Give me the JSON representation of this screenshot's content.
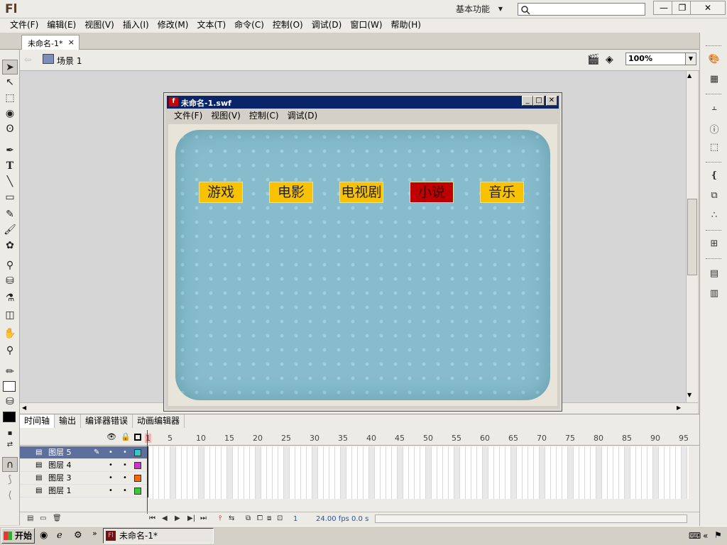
{
  "app": {
    "logo": "Fl",
    "workspace": "基本功能",
    "search_placeholder": ""
  },
  "window_controls": {
    "minimize": "—",
    "restore": "❐",
    "close": "✕"
  },
  "menu": [
    "文件(F)",
    "编辑(E)",
    "视图(V)",
    "插入(I)",
    "修改(M)",
    "文本(T)",
    "命令(C)",
    "控制(O)",
    "调试(D)",
    "窗口(W)",
    "帮助(H)"
  ],
  "document_tab": {
    "label": "未命名-1*",
    "close": "×"
  },
  "editbar": {
    "scene": "场景 1",
    "zoom": "100%"
  },
  "swf_window": {
    "title": "未命名-1.swf",
    "menu": [
      "文件(F)",
      "视图(V)",
      "控制(C)",
      "调试(D)"
    ],
    "nav_buttons": [
      {
        "label": "游戏",
        "active": false
      },
      {
        "label": "电影",
        "active": false
      },
      {
        "label": "电视剧",
        "active": false
      },
      {
        "label": "小说",
        "active": true
      },
      {
        "label": "音乐",
        "active": false
      }
    ],
    "colors": {
      "button": "#f9c200",
      "button_active": "#c00000",
      "board": "#86bccb"
    }
  },
  "timeline": {
    "tabs": [
      "时间轴",
      "输出",
      "编译器错误",
      "动画编辑器"
    ],
    "frame_numbers": [
      "1",
      "5",
      "10",
      "15",
      "20",
      "25",
      "30",
      "35",
      "40",
      "45",
      "50",
      "55",
      "60",
      "65",
      "70",
      "75",
      "80",
      "85",
      "90",
      "95"
    ],
    "layers": [
      {
        "name": "图层 5",
        "color": "#33cccc",
        "selected": true
      },
      {
        "name": "图层 4",
        "color": "#cc33cc",
        "selected": false
      },
      {
        "name": "图层 3",
        "color": "#ff6600",
        "selected": false
      },
      {
        "name": "图层 1",
        "color": "#33cc33",
        "selected": false
      }
    ],
    "current_frame": "1",
    "fps": "24.00 fps",
    "time": "0.0 s"
  },
  "taskbar": {
    "start": "开始",
    "task_item": "未命名-1*",
    "tray_arrows": "«"
  }
}
